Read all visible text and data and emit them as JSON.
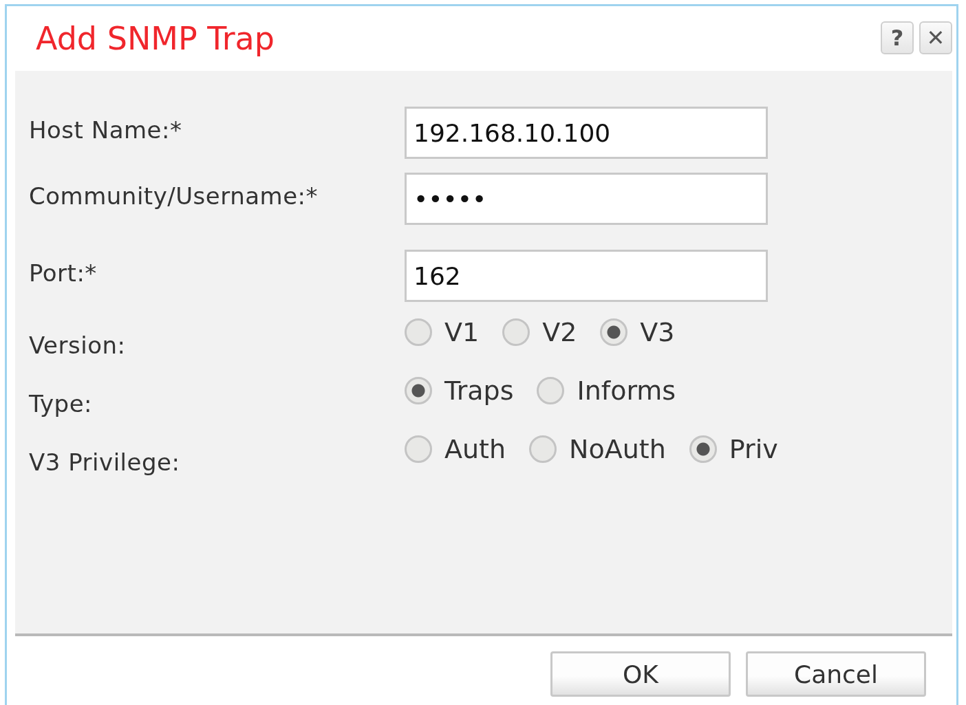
{
  "window": {
    "title": "Add SNMP Trap",
    "help_button": "?",
    "close_button": "✕"
  },
  "fields": [
    {
      "kind": "text",
      "label": "Host Name:*",
      "value": "192.168.10.100"
    },
    {
      "kind": "text",
      "label": "Community/Username:*",
      "value": "•••••"
    },
    {
      "kind": "text",
      "label": "Port:*",
      "value": "162"
    },
    {
      "kind": "radio",
      "label": "Version:",
      "options": [
        {
          "label": "V1",
          "selected": false
        },
        {
          "label": "V2",
          "selected": false
        },
        {
          "label": "V3",
          "selected": true
        }
      ]
    },
    {
      "kind": "radio",
      "label": "Type:",
      "options": [
        {
          "label": "Traps",
          "selected": true
        },
        {
          "label": "Informs",
          "selected": false
        }
      ]
    },
    {
      "kind": "radio",
      "label": "V3 Privilege:",
      "options": [
        {
          "label": "Auth",
          "selected": false
        },
        {
          "label": "NoAuth",
          "selected": false
        },
        {
          "label": "Priv",
          "selected": true
        }
      ]
    }
  ],
  "buttons": [
    "OK",
    "Cancel"
  ]
}
